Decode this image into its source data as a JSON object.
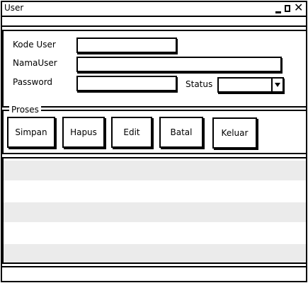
{
  "window": {
    "title": "User"
  },
  "form": {
    "kode_user_label": "Kode User",
    "kode_user_value": "",
    "nama_user_label": "NamaUser",
    "nama_user_value": "",
    "password_label": "Password",
    "password_value": "",
    "status_label": "Status",
    "status_value": ""
  },
  "proses": {
    "title": "Proses",
    "buttons": {
      "simpan": "Simpan",
      "hapus": "Hapus",
      "edit": "Edit",
      "batal": "Batal",
      "keluar": "Keluar"
    }
  },
  "table": {
    "rows": [
      "",
      "",
      "",
      "",
      "",
      ""
    ]
  },
  "colors": {
    "border": "#000000",
    "stripe": "#ebebeb",
    "background": "#ffffff"
  },
  "icons": [
    "minimize-icon",
    "maximize-icon",
    "close-icon",
    "chevron-down-icon"
  ]
}
